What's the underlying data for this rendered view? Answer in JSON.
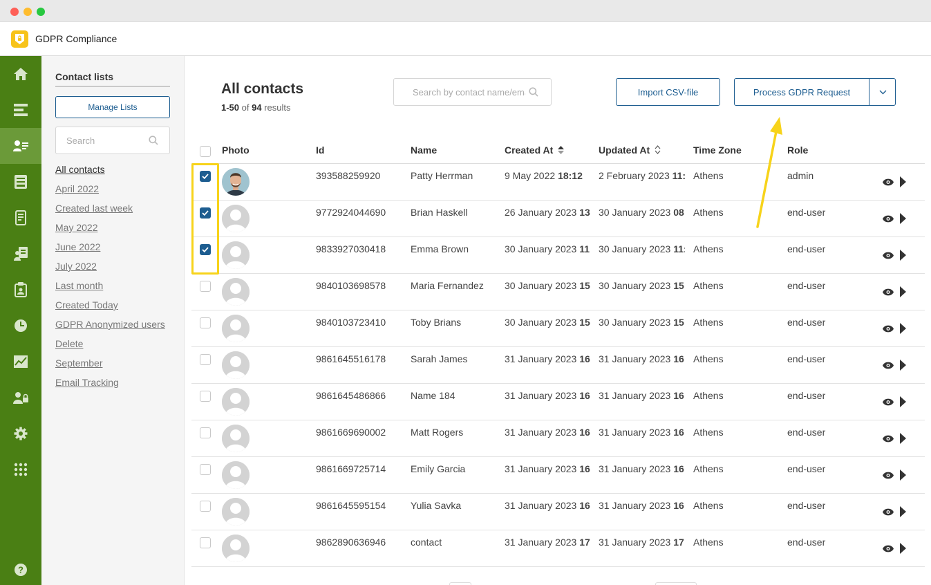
{
  "app": {
    "title": "GDPR Compliance",
    "logo_icon": "lock-badge-icon",
    "brand_color": "#f7c31a",
    "rail_color": "#4a7f14"
  },
  "rail": {
    "items": [
      {
        "icon": "home-icon"
      },
      {
        "icon": "dashboard-icon"
      },
      {
        "icon": "contacts-icon",
        "active": true
      },
      {
        "icon": "inbox-icon"
      },
      {
        "icon": "document-icon"
      },
      {
        "icon": "consent-icon"
      },
      {
        "icon": "clipboard-icon"
      },
      {
        "icon": "clock-icon"
      },
      {
        "icon": "chart-icon"
      },
      {
        "icon": "user-lock-icon"
      },
      {
        "icon": "gear-icon"
      },
      {
        "icon": "apps-grid-icon"
      },
      {
        "icon": "help-icon"
      }
    ]
  },
  "sidebar": {
    "title": "Contact lists",
    "manage_label": "Manage Lists",
    "search_placeholder": "Search",
    "lists": [
      "All contacts",
      "April 2022",
      "Created last week",
      "May 2022",
      "June 2022",
      "July 2022",
      "Last month",
      "Created Today",
      "GDPR Anonymized users",
      "Delete",
      "September",
      "Email Tracking"
    ]
  },
  "main": {
    "title": "All contacts",
    "range": "1-50",
    "of_label": "of",
    "total": "94",
    "results_label": "results",
    "search_placeholder": "Search by contact name/email",
    "import_label": "Import CSV-file",
    "gdpr_label": "Process GDPR Request"
  },
  "table": {
    "columns": {
      "photo": "Photo",
      "id": "Id",
      "name": "Name",
      "created_at": "Created At",
      "updated_at": "Updated At",
      "time_zone": "Time Zone",
      "role": "Role"
    },
    "rows": [
      {
        "checked": true,
        "photo": "photo",
        "id": "393588259920",
        "name": "Patty Herrman",
        "created_date": "9 May 2022",
        "created_time": "18:12",
        "updated_date": "2 February 2023",
        "updated_time": "11:",
        "tz": "Athens",
        "role": "admin"
      },
      {
        "checked": true,
        "photo": "placeholder",
        "id": "9772924044690",
        "name": "Brian Haskell",
        "created_date": "26 January 2023",
        "created_time": "13:",
        "updated_date": "30 January 2023",
        "updated_time": "08:",
        "tz": "Athens",
        "role": "end-user"
      },
      {
        "checked": true,
        "photo": "placeholder",
        "id": "9833927030418",
        "name": "Emma Brown",
        "created_date": "30 January 2023",
        "created_time": "11:",
        "updated_date": "30 January 2023",
        "updated_time": "11:",
        "tz": "Athens",
        "role": "end-user"
      },
      {
        "checked": false,
        "photo": "placeholder",
        "id": "9840103698578",
        "name": "Maria Fernandez",
        "created_date": "30 January 2023",
        "created_time": "15:",
        "updated_date": "30 January 2023",
        "updated_time": "15:",
        "tz": "Athens",
        "role": "end-user"
      },
      {
        "checked": false,
        "photo": "placeholder",
        "id": "9840103723410",
        "name": "Toby Brians",
        "created_date": "30 January 2023",
        "created_time": "15:",
        "updated_date": "30 January 2023",
        "updated_time": "15:",
        "tz": "Athens",
        "role": "end-user"
      },
      {
        "checked": false,
        "photo": "placeholder",
        "id": "9861645516178",
        "name": "Sarah James",
        "created_date": "31 January 2023",
        "created_time": "16:",
        "updated_date": "31 January 2023",
        "updated_time": "16:",
        "tz": "Athens",
        "role": "end-user"
      },
      {
        "checked": false,
        "photo": "placeholder",
        "id": "9861645486866",
        "name": "Name 184",
        "created_date": "31 January 2023",
        "created_time": "16:",
        "updated_date": "31 January 2023",
        "updated_time": "16:",
        "tz": "Athens",
        "role": "end-user"
      },
      {
        "checked": false,
        "photo": "placeholder",
        "id": "9861669690002",
        "name": "Matt Rogers",
        "created_date": "31 January 2023",
        "created_time": "16:",
        "updated_date": "31 January 2023",
        "updated_time": "16:",
        "tz": "Athens",
        "role": "end-user"
      },
      {
        "checked": false,
        "photo": "placeholder",
        "id": "9861669725714",
        "name": "Emily Garcia",
        "created_date": "31 January 2023",
        "created_time": "16:",
        "updated_date": "31 January 2023",
        "updated_time": "16:",
        "tz": "Athens",
        "role": "end-user"
      },
      {
        "checked": false,
        "photo": "placeholder",
        "id": "9861645595154",
        "name": "Yulia Savka",
        "created_date": "31 January 2023",
        "created_time": "16:",
        "updated_date": "31 January 2023",
        "updated_time": "16:",
        "tz": "Athens",
        "role": "end-user"
      },
      {
        "checked": false,
        "photo": "placeholder",
        "id": "9862890636946",
        "name": "contact",
        "created_date": "31 January 2023",
        "created_time": "17:",
        "updated_date": "31 January 2023",
        "updated_time": "17:",
        "tz": "Athens",
        "role": "end-user"
      }
    ]
  },
  "annotations": {
    "highlight_color": "#f7d31a"
  }
}
